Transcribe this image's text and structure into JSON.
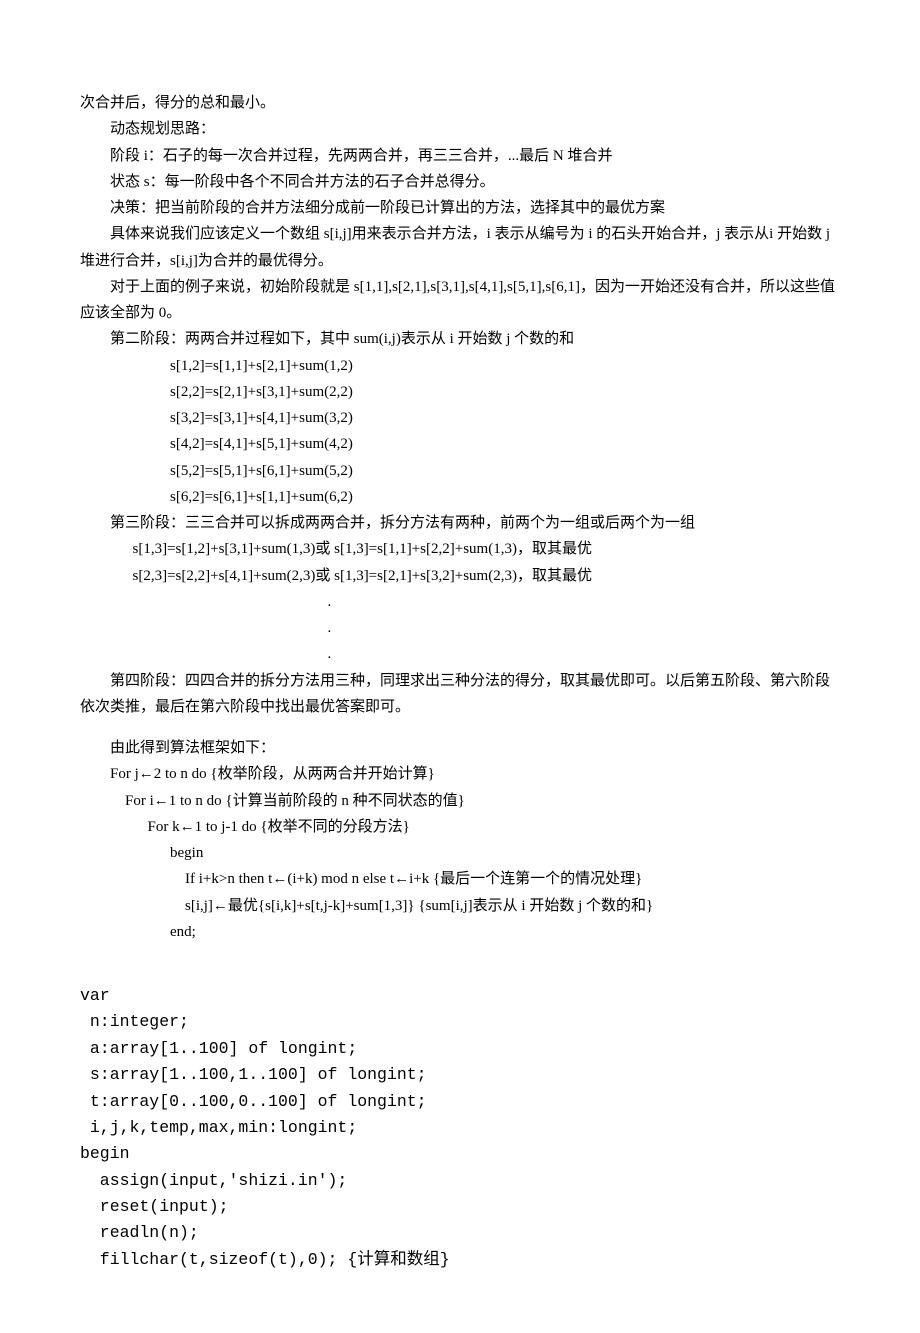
{
  "p1": "次合并后，得分的总和最小。",
  "p2": "动态规划思路：",
  "p3": "阶段 i：石子的每一次合并过程，先两两合并，再三三合并，...最后 N 堆合并",
  "p4": "状态 s：每一阶段中各个不同合并方法的石子合并总得分。",
  "p5": "决策：把当前阶段的合并方法细分成前一阶段已计算出的方法，选择其中的最优方案",
  "p6": "具体来说我们应该定义一个数组 s[i,j]用来表示合并方法，i 表示从编号为 i 的石头开始合并，j 表示从i 开始数 j 堆进行合并，s[i,j]为合并的最优得分。",
  "p7": "对于上面的例子来说，初始阶段就是 s[1,1],s[2,1],s[3,1],s[4,1],s[5,1],s[6,1]，因为一开始还没有合并，所以这些值应该全部为 0。",
  "p8": "第二阶段：两两合并过程如下，其中 sum(i,j)表示从 i 开始数 j 个数的和",
  "eq1": "s[1,2]=s[1,1]+s[2,1]+sum(1,2)",
  "eq2": "s[2,2]=s[2,1]+s[3,1]+sum(2,2)",
  "eq3": "s[3,2]=s[3,1]+s[4,1]+sum(3,2)",
  "eq4": "s[4,2]=s[4,1]+s[5,1]+sum(4,2)",
  "eq5": "s[5,2]=s[5,1]+s[6,1]+sum(5,2)",
  "eq6": "s[6,2]=s[6,1]+s[1,1]+sum(6,2)",
  "p9": "第三阶段：三三合并可以拆成两两合并，拆分方法有两种，前两个为一组或后两个为一组",
  "eq7": "s[1,3]=s[1,2]+s[3,1]+sum(1,3)或 s[1,3]=s[1,1]+s[2,2]+sum(1,3)，取其最优",
  "eq8": "s[2,3]=s[2,2]+s[4,1]+sum(2,3)或 s[1,3]=s[2,1]+s[3,2]+sum(2,3)，取其最优",
  "dot": ".",
  "p10": "第四阶段：四四合并的拆分方法用三种，同理求出三种分法的得分，取其最优即可。以后第五阶段、第六阶段依次类推，最后在第六阶段中找出最优答案即可。",
  "p11": "由此得到算法框架如下：",
  "c1": "For j←2 to n do       {枚举阶段，从两两合并开始计算}",
  "c2": "For i←1 to n do      {计算当前阶段的 n 种不同状态的值}",
  "c3": "For k←1 to j-1 do {枚举不同的分段方法}",
  "c4": "begin",
  "c5": "If i+k>n then t←(i+k) mod n else t←i+k {最后一个连第一个的情况处理}",
  "c6": "s[i,j]←最优{s[i,k]+s[t,j-k]+sum[1,3]} {sum[i,j]表示从 i 开始数 j 个数的和}",
  "c7": "end;",
  "m1": "var",
  "m2": "n:integer;",
  "m3": "a:array[1..100] of longint;",
  "m4": "s:array[1..100,1..100] of longint;",
  "m5": "t:array[0..100,0..100] of longint;",
  "m6": "i,j,k,temp,max,min:longint;",
  "m7": "begin",
  "m8": "assign(input,'shizi.in');",
  "m9": "reset(input);",
  "m10": "readln(n);",
  "m11": "fillchar(t,sizeof(t),0);     {计算和数组}"
}
